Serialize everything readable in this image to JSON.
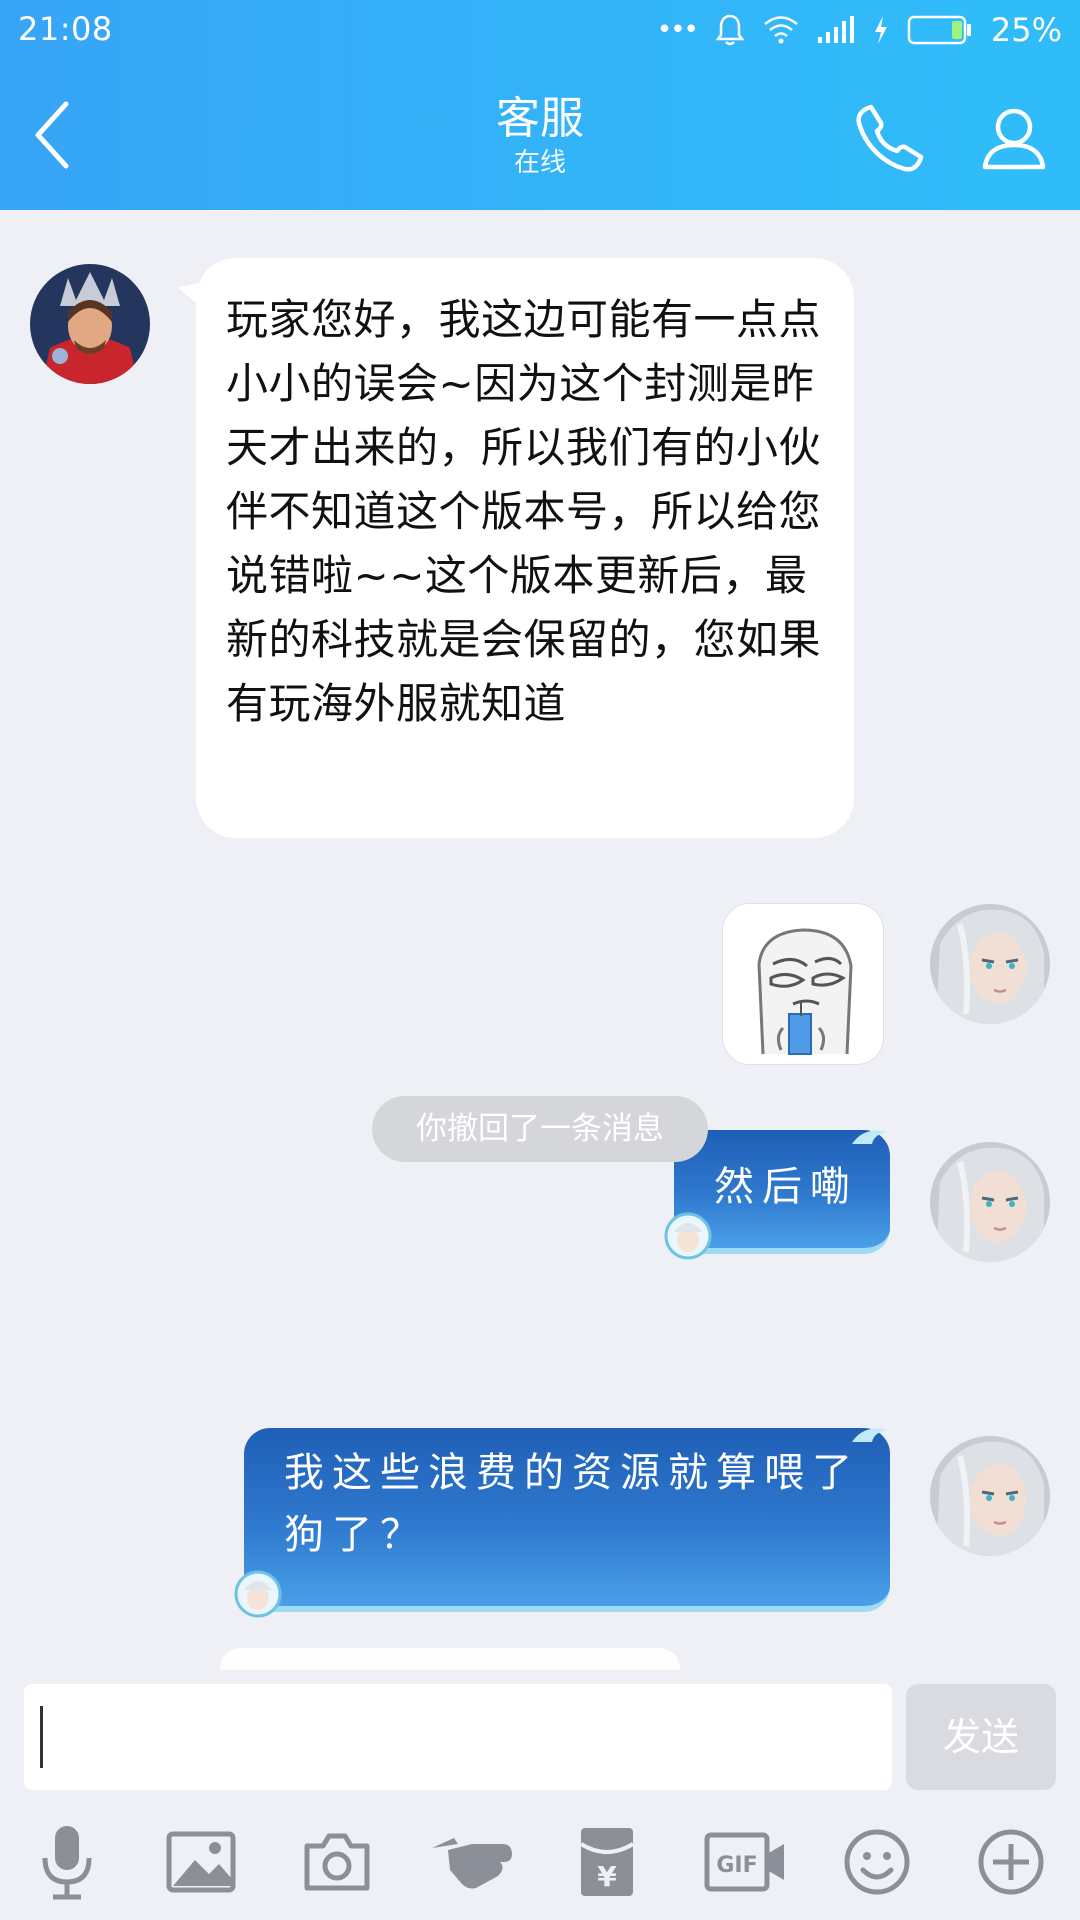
{
  "status_bar": {
    "time": "21:08",
    "dots": "•••",
    "battery_percent": "25%"
  },
  "header": {
    "back_icon": "chevron-left-icon",
    "title": "客服",
    "subtitle": "在线",
    "call_icon": "phone-icon",
    "profile_icon": "person-icon"
  },
  "messages": [
    {
      "side": "incoming",
      "type": "text",
      "text": "玩家您好，我这边可能有一点点小小的误会~因为这个封测是昨天才出来的，所以我们有的小伙伴不知道这个版本号，所以给您说错啦~~这个版本更新后，最新的科技就是会保留的，您如果有玩海外服就知道"
    },
    {
      "side": "outgoing",
      "type": "sticker",
      "sticker": "doodle-face-drinking-sticker"
    },
    {
      "side": "outgoing",
      "type": "text",
      "text": "然后嘞"
    },
    {
      "side": "system",
      "type": "notice",
      "text": "你撤回了一条消息"
    },
    {
      "side": "outgoing",
      "type": "text",
      "text": "我这些浪费的资源就算喂了狗了？"
    }
  ],
  "input": {
    "value": "",
    "send_label": "发送"
  },
  "toolbar": {
    "items": [
      "microphone-icon",
      "image-icon",
      "camera-icon",
      "poke-hand-icon",
      "red-packet-icon",
      "gif-icon",
      "emoji-icon",
      "plus-icon"
    ],
    "gif_label": "GIF",
    "yuan_label": "¥"
  },
  "colors": {
    "header_start": "#37a4f6",
    "header_end": "#2fbdf9",
    "chat_background": "#eef0f6",
    "outgoing_bubble": "#2f79cf",
    "send_button_disabled": "#d9dbe0"
  }
}
